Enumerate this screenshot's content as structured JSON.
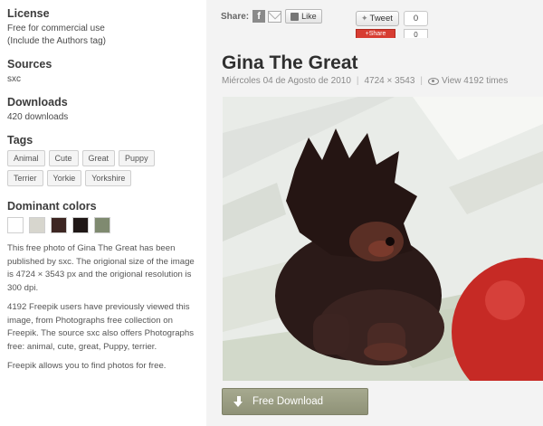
{
  "sidebar": {
    "license": {
      "title": "License",
      "line1": "Free for commercial use",
      "line2": "(Include the Authors tag)"
    },
    "sources": {
      "title": "Sources",
      "value": "sxc"
    },
    "downloads": {
      "title": "Downloads",
      "value": "420 downloads"
    },
    "tags": {
      "title": "Tags",
      "items": [
        "Animal",
        "Cute",
        "Great",
        "Puppy",
        "Terrier",
        "Yorkie",
        "Yorkshire"
      ]
    },
    "dominant_colors": {
      "title": "Dominant colors",
      "swatches": [
        "#ffffff",
        "#d7d6ce",
        "#3d2622",
        "#1f1716",
        "#7f8a70"
      ]
    },
    "description": {
      "p1": "This free photo of Gina The Great has been published by sxc. The origional size of the image is 4724 × 3543 px and the origional resolution is 300 dpi.",
      "p2": "4192 Freepik users have previously viewed this image, from Photographs free collection on Freepik. The source sxc also offers Photographs free: animal, cute, great, Puppy, terrier.",
      "p3": "Freepik allows you to find photos for free."
    }
  },
  "share": {
    "label": "Share:",
    "like_label": "Like",
    "tweet_label": "Tweet",
    "tweet_count": "0",
    "gplus_label": "+Share",
    "gplus_count": "0"
  },
  "photo_page": {
    "title": "Gina The Great",
    "date": "Miércoles 04 de Agosto de 2010",
    "dimensions": "4724 × 3543",
    "views": "View 4192 times",
    "download_label": "Free Download"
  },
  "icons": {
    "facebook": "facebook-icon",
    "mail": "mail-icon",
    "like": "thumbs-up-icon",
    "twitter": "twitter-bird-icon",
    "eye": "eye-icon",
    "download": "download-arrow-icon"
  }
}
